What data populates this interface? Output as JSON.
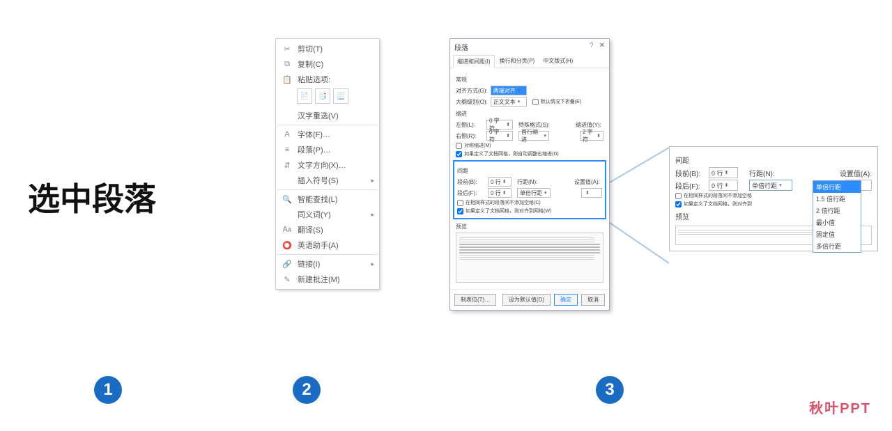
{
  "main_title": "选中段落",
  "steps": {
    "n1": "1",
    "n2": "2",
    "n3": "3"
  },
  "brand": "秋叶PPT",
  "context_menu": {
    "cut": "剪切(T)",
    "copy": "复制(C)",
    "paste_options": "粘贴选项:",
    "hanzi": "汉字重选(V)",
    "font": "字体(F)…",
    "paragraph": "段落(P)…",
    "text_direction": "文字方向(X)…",
    "insert_symbol": "插入符号(S)",
    "smart_lookup": "智能查找(L)",
    "synonyms": "同义词(Y)",
    "translate": "翻译(S)",
    "english_helper": "英语助手(A)",
    "link": "链接(I)",
    "new_comment": "新建批注(M)"
  },
  "dialog": {
    "title": "段落",
    "tabs": {
      "t1": "缩进和间距(I)",
      "t2": "换行和分页(P)",
      "t3": "中文版式(H)"
    },
    "general": "常规",
    "alignment_lbl": "对齐方式(G):",
    "alignment_val": "两端对齐",
    "outline_lbl": "大纲级别(O):",
    "outline_val": "正文文本",
    "collapsed_cb": "默认情况下折叠(E)",
    "indent": "缩进",
    "left_lbl": "左侧(L):",
    "left_val": "0 字符",
    "right_lbl": "右侧(R):",
    "right_val": "0 字符",
    "special_lbl": "特殊格式(S):",
    "special_val": "首行缩进",
    "indent_val_lbl": "缩进值(Y):",
    "indent_val": "2 字符",
    "sym_cb": "对称缩进(M)",
    "auto_cb": "如果定义了文档网格，则自动调整右缩进(D)",
    "spacing": "间距",
    "before_lbl": "段前(B):",
    "before_val": "0 行",
    "after_lbl": "段后(F):",
    "after_val": "0 行",
    "line_lbl": "行距(N):",
    "line_val": "单倍行距",
    "setval_lbl": "设置值(A):",
    "nospace_cb": "在相同样式的段落间不添加空格(C)",
    "snap_cb": "如果定义了文档网格，则对齐到网格(W)",
    "preview": "预览",
    "btn_tabs": "制表位(T)…",
    "btn_default": "设为默认值(D)",
    "btn_ok": "确定",
    "btn_cancel": "取消"
  },
  "zoom": {
    "spacing": "间距",
    "before_lbl": "段前(B):",
    "before_val": "0 行",
    "after_lbl": "段后(F):",
    "after_val": "0 行",
    "line_lbl": "行距(N):",
    "line_val": "单倍行距",
    "setval_lbl": "设置值(A):",
    "nospace_cb": "在相同样式的段落间不添加空格",
    "snap_cb": "如果定义了文档网格，则对齐到",
    "preview": "预览",
    "dropdown": [
      "单倍行距",
      "1.5 倍行距",
      "2 倍行距",
      "最小值",
      "固定值",
      "多倍行距"
    ]
  }
}
